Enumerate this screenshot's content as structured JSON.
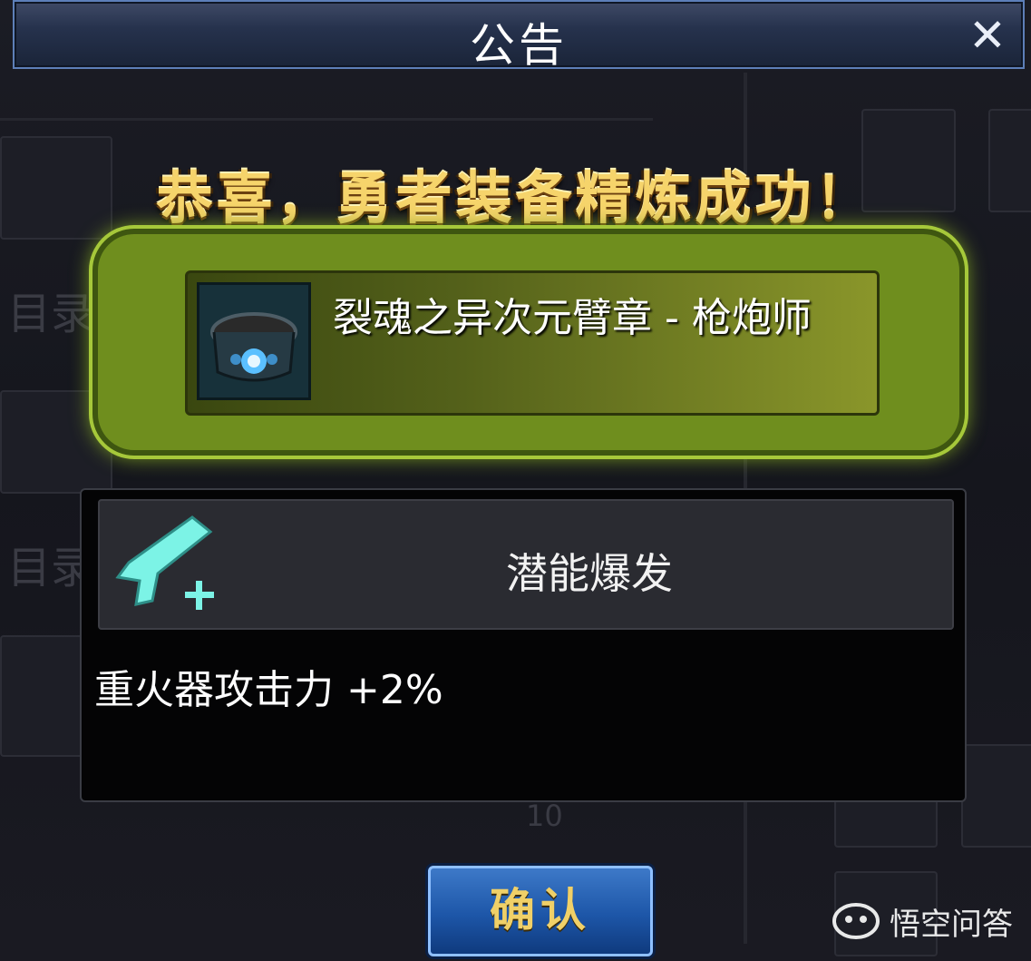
{
  "dialog": {
    "title": "公告",
    "close_icon": "close-icon"
  },
  "headline": "恭喜，勇者装备精炼成功！",
  "item": {
    "name": "裂魂之异次元臂章 - 枪炮师",
    "icon": "armband-item-icon"
  },
  "skill": {
    "name": "潜能爆发",
    "icon": "heavy-weapon-plus-icon"
  },
  "effect": "重火器攻击力 +2%",
  "confirm_label": "确认",
  "watermark": {
    "text": "悟空问答",
    "icon": "wukong-logo-icon"
  },
  "background": {
    "label_1": "目录",
    "label_2": "目录",
    "number": "10"
  },
  "colors": {
    "headline_gold": "#f6d46b",
    "frame_green": "#6f8e1e",
    "button_blue": "#1d56a8",
    "skill_icon_cyan": "#7cf3e6"
  }
}
